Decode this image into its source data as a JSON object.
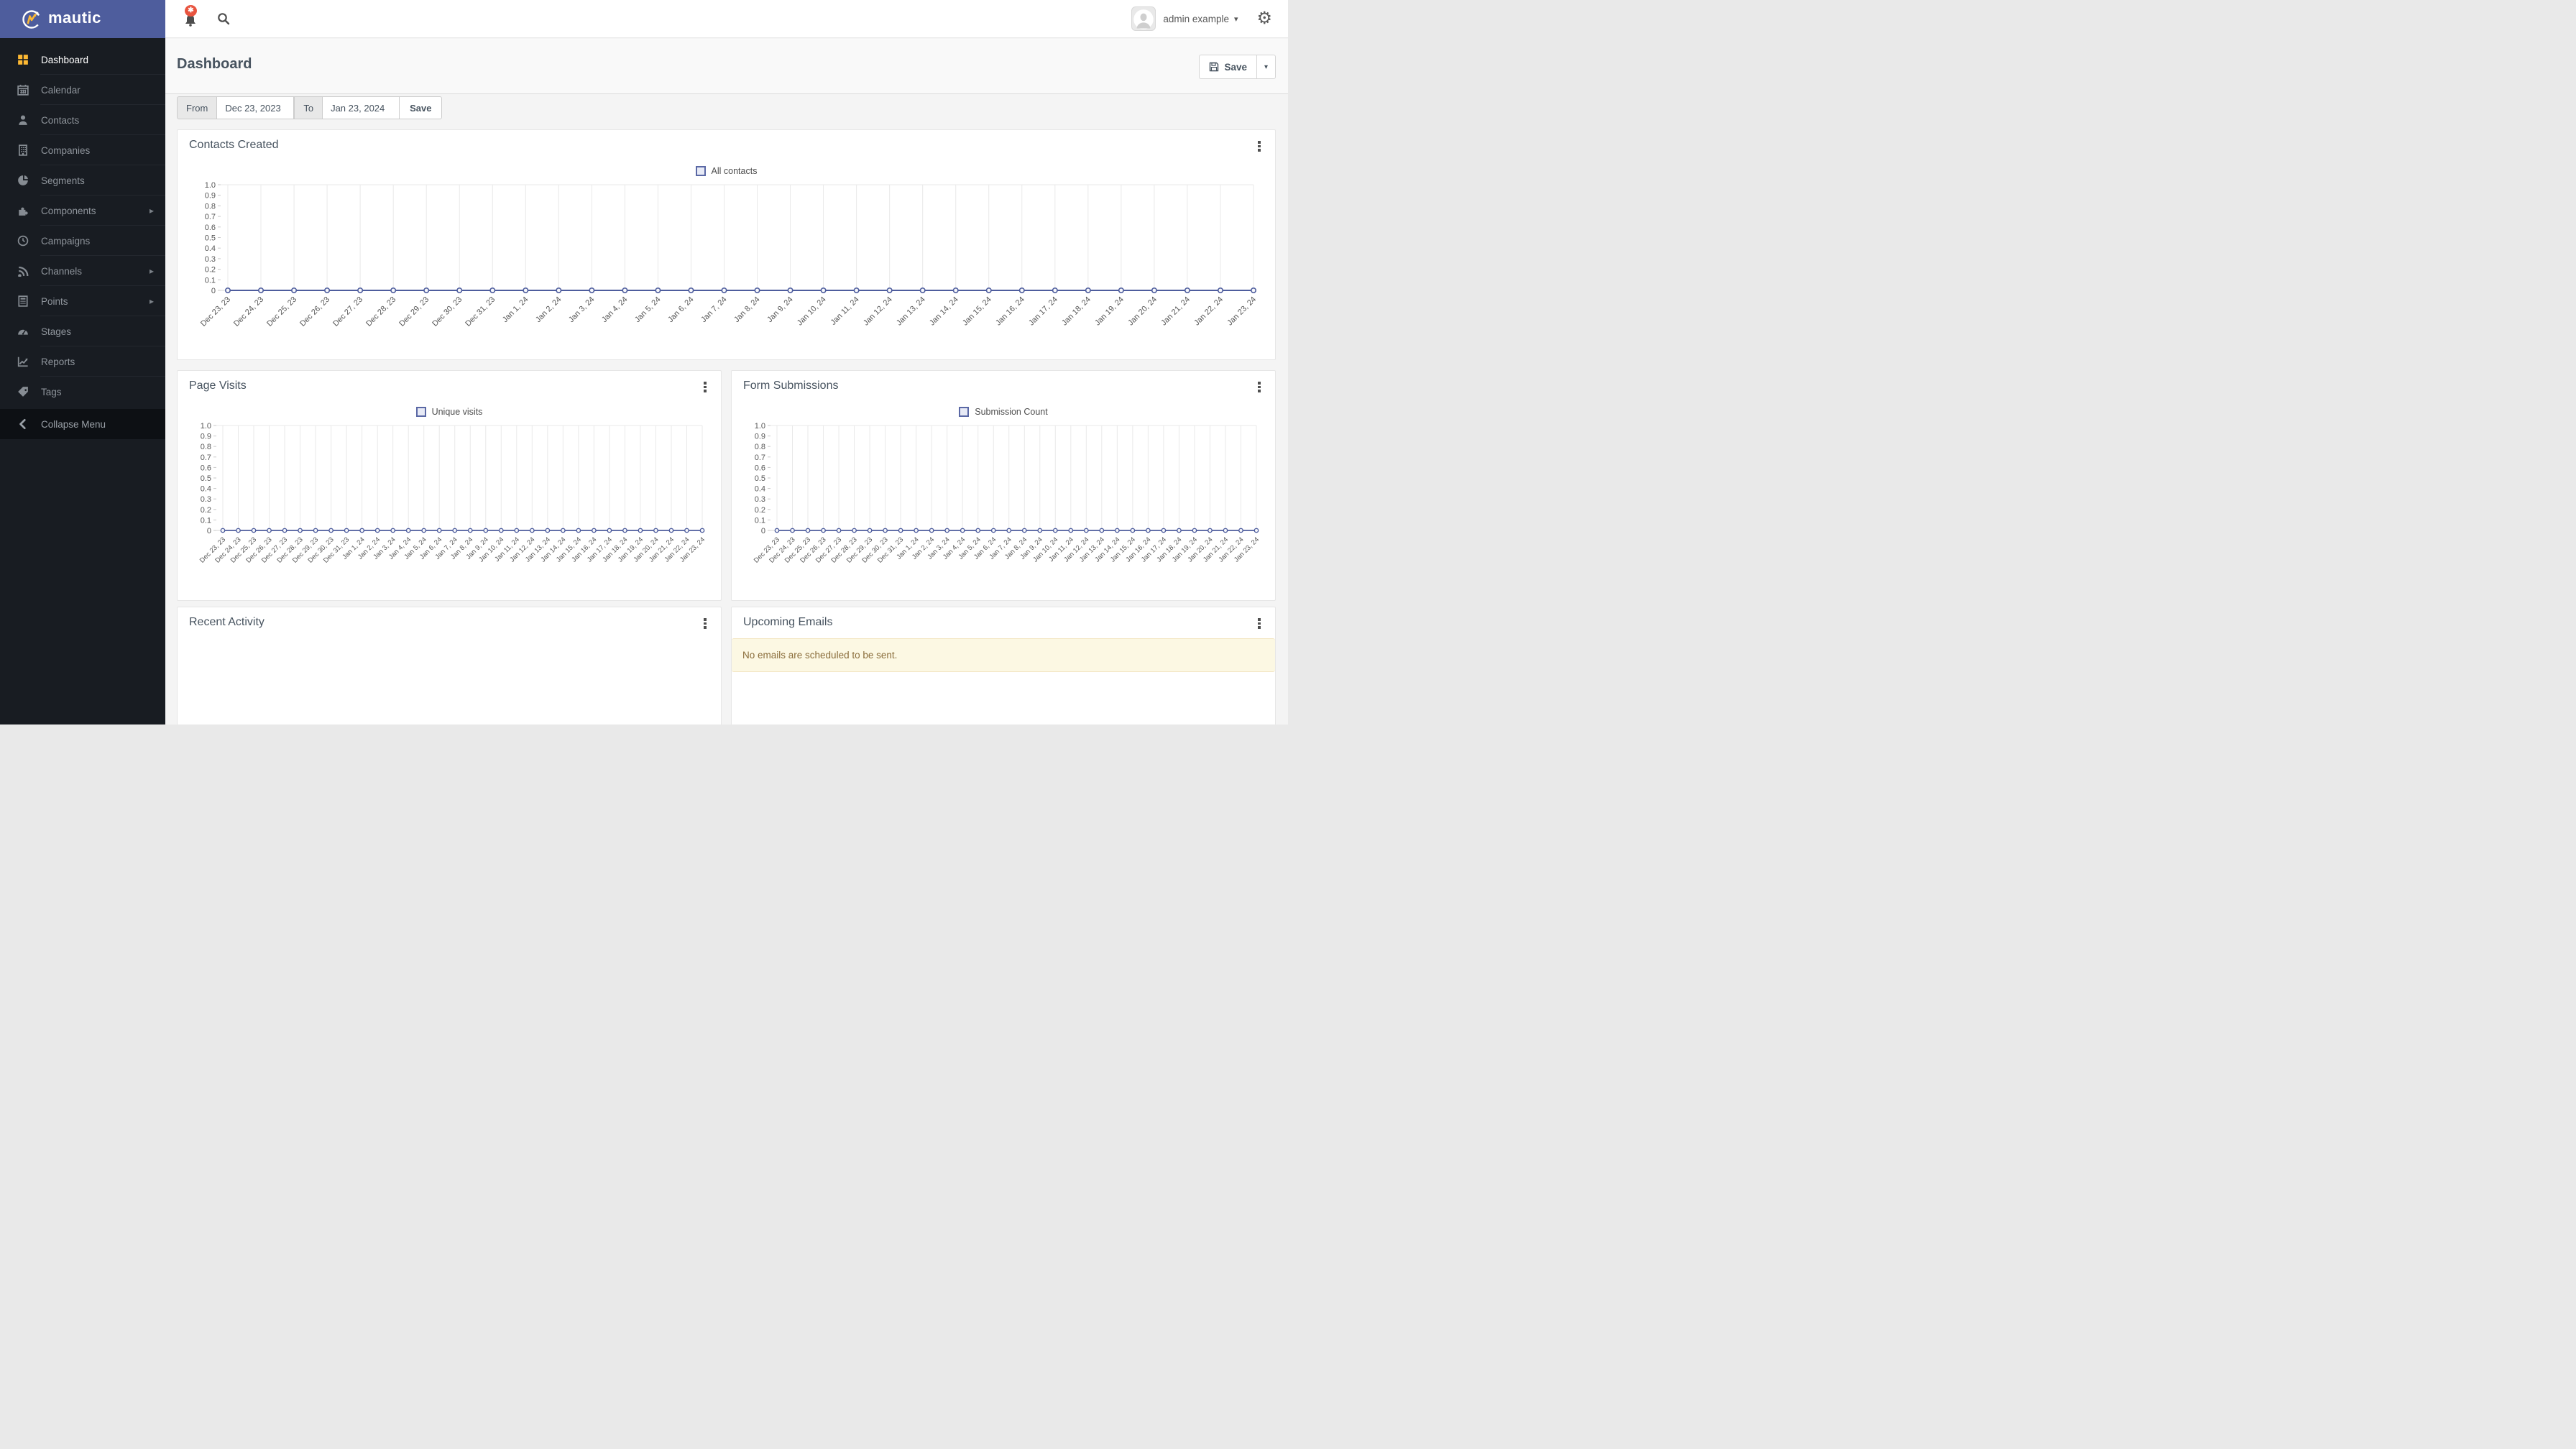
{
  "app": {
    "brand": "mautic"
  },
  "colors": {
    "accent": "#4e5d9d",
    "sidebar_bg": "#181c22",
    "logo_bar_bg": "#4e5d9d",
    "active_icon_orange": "#fdb933",
    "badge_red": "#e8543f",
    "alert_bg": "#fcf8e3",
    "alert_text": "#8a6d3b",
    "title_slate": "#47535f"
  },
  "topbar": {
    "bell_icon": "bell-icon",
    "badge_symbol": "✱",
    "search_icon": "search-icon",
    "user_name": "admin example",
    "caret_icon": "chevron-down-icon",
    "gear_icon": "gear-icon",
    "gear_glyph": "⚙"
  },
  "sidebar": {
    "items": [
      {
        "label": "Dashboard",
        "icon": "grid",
        "active": true,
        "submenu": false
      },
      {
        "label": "Calendar",
        "icon": "calendar",
        "active": false,
        "submenu": false
      },
      {
        "label": "Contacts",
        "icon": "user",
        "active": false,
        "submenu": false
      },
      {
        "label": "Companies",
        "icon": "building",
        "active": false,
        "submenu": false
      },
      {
        "label": "Segments",
        "icon": "pie",
        "active": false,
        "submenu": false
      },
      {
        "label": "Components",
        "icon": "puzzle",
        "active": false,
        "submenu": true
      },
      {
        "label": "Campaigns",
        "icon": "clock",
        "active": false,
        "submenu": false
      },
      {
        "label": "Channels",
        "icon": "rss",
        "active": false,
        "submenu": true
      },
      {
        "label": "Points",
        "icon": "calculator",
        "active": false,
        "submenu": true
      },
      {
        "label": "Stages",
        "icon": "gauge",
        "active": false,
        "submenu": false
      },
      {
        "label": "Reports",
        "icon": "chartline",
        "active": false,
        "submenu": false
      },
      {
        "label": "Tags",
        "icon": "tag",
        "active": false,
        "submenu": false
      }
    ],
    "submenu_arrow": "▸",
    "collapse_label": "Collapse Menu",
    "collapse_icon": "chevron-left-icon"
  },
  "page": {
    "title": "Dashboard",
    "save_label": "Save",
    "save_icon": "floppy-icon",
    "save_caret": "▾"
  },
  "date_filter": {
    "from_label": "From",
    "from_value": "Dec 23, 2023",
    "to_label": "To",
    "to_value": "Jan 23, 2024",
    "save_label": "Save"
  },
  "panels": {
    "contacts_created": {
      "title": "Contacts Created"
    },
    "page_visits": {
      "title": "Page Visits"
    },
    "form_submissions": {
      "title": "Form Submissions"
    },
    "recent_activity": {
      "title": "Recent Activity"
    },
    "upcoming_emails": {
      "title": "Upcoming Emails",
      "empty_message": "No emails are scheduled to be sent."
    }
  },
  "chart_data": [
    {
      "type": "line",
      "title": "Contacts Created",
      "legend_position": "top",
      "grid": "vertical",
      "marker": "circle",
      "x_label_rotation": -45,
      "ylim": [
        0,
        1
      ],
      "y_ticks": [
        "1.0",
        "0.9",
        "0.8",
        "0.7",
        "0.6",
        "0.5",
        "0.4",
        "0.3",
        "0.2",
        "0.1",
        "0"
      ],
      "categories": [
        "Dec 23, 23",
        "Dec 24, 23",
        "Dec 25, 23",
        "Dec 26, 23",
        "Dec 27, 23",
        "Dec 28, 23",
        "Dec 29, 23",
        "Dec 30, 23",
        "Dec 31, 23",
        "Jan 1, 24",
        "Jan 2, 24",
        "Jan 3, 24",
        "Jan 4, 24",
        "Jan 5, 24",
        "Jan 6, 24",
        "Jan 7, 24",
        "Jan 8, 24",
        "Jan 9, 24",
        "Jan 10, 24",
        "Jan 11, 24",
        "Jan 12, 24",
        "Jan 13, 24",
        "Jan 14, 24",
        "Jan 15, 24",
        "Jan 16, 24",
        "Jan 17, 24",
        "Jan 18, 24",
        "Jan 19, 24",
        "Jan 20, 24",
        "Jan 21, 24",
        "Jan 22, 24",
        "Jan 23, 24"
      ],
      "series": [
        {
          "name": "All contacts",
          "values": [
            0,
            0,
            0,
            0,
            0,
            0,
            0,
            0,
            0,
            0,
            0,
            0,
            0,
            0,
            0,
            0,
            0,
            0,
            0,
            0,
            0,
            0,
            0,
            0,
            0,
            0,
            0,
            0,
            0,
            0,
            0,
            0
          ]
        }
      ]
    },
    {
      "type": "line",
      "title": "Page Visits",
      "legend_position": "top",
      "grid": "vertical",
      "marker": "circle",
      "x_label_rotation": -45,
      "ylim": [
        0,
        1
      ],
      "y_ticks": [
        "1.0",
        "0.9",
        "0.8",
        "0.7",
        "0.6",
        "0.5",
        "0.4",
        "0.3",
        "0.2",
        "0.1",
        "0"
      ],
      "categories": [
        "Dec 23, 23",
        "Dec 24, 23",
        "Dec 25, 23",
        "Dec 26, 23",
        "Dec 27, 23",
        "Dec 28, 23",
        "Dec 29, 23",
        "Dec 30, 23",
        "Dec 31, 23",
        "Jan 1, 24",
        "Jan 2, 24",
        "Jan 3, 24",
        "Jan 4, 24",
        "Jan 5, 24",
        "Jan 6, 24",
        "Jan 7, 24",
        "Jan 8, 24",
        "Jan 9, 24",
        "Jan 10, 24",
        "Jan 11, 24",
        "Jan 12, 24",
        "Jan 13, 24",
        "Jan 14, 24",
        "Jan 15, 24",
        "Jan 16, 24",
        "Jan 17, 24",
        "Jan 18, 24",
        "Jan 19, 24",
        "Jan 20, 24",
        "Jan 21, 24",
        "Jan 22, 24",
        "Jan 23, 24"
      ],
      "series": [
        {
          "name": "Unique visits",
          "values": [
            0,
            0,
            0,
            0,
            0,
            0,
            0,
            0,
            0,
            0,
            0,
            0,
            0,
            0,
            0,
            0,
            0,
            0,
            0,
            0,
            0,
            0,
            0,
            0,
            0,
            0,
            0,
            0,
            0,
            0,
            0,
            0
          ]
        }
      ]
    },
    {
      "type": "line",
      "title": "Form Submissions",
      "legend_position": "top",
      "grid": "vertical",
      "marker": "circle",
      "x_label_rotation": -45,
      "ylim": [
        0,
        1
      ],
      "y_ticks": [
        "1.0",
        "0.9",
        "0.8",
        "0.7",
        "0.6",
        "0.5",
        "0.4",
        "0.3",
        "0.2",
        "0.1",
        "0"
      ],
      "categories": [
        "Dec 23, 23",
        "Dec 24, 23",
        "Dec 25, 23",
        "Dec 26, 23",
        "Dec 27, 23",
        "Dec 28, 23",
        "Dec 29, 23",
        "Dec 30, 23",
        "Dec 31, 23",
        "Jan 1, 24",
        "Jan 2, 24",
        "Jan 3, 24",
        "Jan 4, 24",
        "Jan 5, 24",
        "Jan 6, 24",
        "Jan 7, 24",
        "Jan 8, 24",
        "Jan 9, 24",
        "Jan 10, 24",
        "Jan 11, 24",
        "Jan 12, 24",
        "Jan 13, 24",
        "Jan 14, 24",
        "Jan 15, 24",
        "Jan 16, 24",
        "Jan 17, 24",
        "Jan 18, 24",
        "Jan 19, 24",
        "Jan 20, 24",
        "Jan 21, 24",
        "Jan 22, 24",
        "Jan 23, 24"
      ],
      "series": [
        {
          "name": "Submission Count",
          "values": [
            0,
            0,
            0,
            0,
            0,
            0,
            0,
            0,
            0,
            0,
            0,
            0,
            0,
            0,
            0,
            0,
            0,
            0,
            0,
            0,
            0,
            0,
            0,
            0,
            0,
            0,
            0,
            0,
            0,
            0,
            0,
            0
          ]
        }
      ]
    }
  ]
}
